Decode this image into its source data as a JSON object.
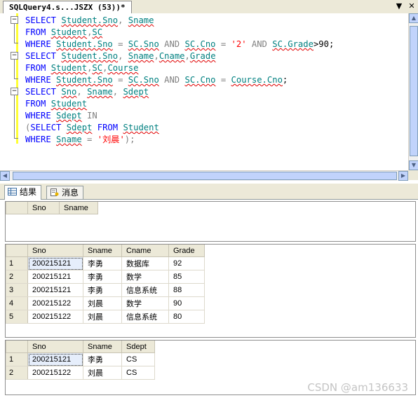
{
  "document_tab": {
    "title": "SQLQuery4.s...JSZX (53))*"
  },
  "editor": {
    "lines": [
      [
        {
          "t": "SELECT ",
          "c": "kw"
        },
        {
          "t": "Student.Sno",
          "c": "id"
        },
        {
          "t": ", ",
          "c": "op"
        },
        {
          "t": "Sname",
          "c": "id"
        }
      ],
      [
        {
          "t": "FROM ",
          "c": "kw"
        },
        {
          "t": "Student",
          "c": "id"
        },
        {
          "t": ",",
          "c": "op"
        },
        {
          "t": "SC",
          "c": "id"
        }
      ],
      [
        {
          "t": "WHERE ",
          "c": "kw"
        },
        {
          "t": "Student.Sno",
          "c": "id"
        },
        {
          "t": " = ",
          "c": "op"
        },
        {
          "t": "SC.Sno",
          "c": "id"
        },
        {
          "t": " AND ",
          "c": "op"
        },
        {
          "t": "SC.Cno",
          "c": "id"
        },
        {
          "t": " = ",
          "c": "op"
        },
        {
          "t": "'2'",
          "c": "str"
        },
        {
          "t": " AND ",
          "c": "op"
        },
        {
          "t": "SC.Grade",
          "c": "id"
        },
        {
          "t": ">90;",
          "c": "tx"
        }
      ],
      [
        {
          "t": "SELECT ",
          "c": "kw"
        },
        {
          "t": "Student.Sno",
          "c": "id"
        },
        {
          "t": ", ",
          "c": "op"
        },
        {
          "t": "Sname",
          "c": "id"
        },
        {
          "t": ",",
          "c": "op"
        },
        {
          "t": "Cname",
          "c": "id"
        },
        {
          "t": ",",
          "c": "op"
        },
        {
          "t": "Grade",
          "c": "id"
        }
      ],
      [
        {
          "t": "FROM ",
          "c": "kw"
        },
        {
          "t": "Student",
          "c": "id"
        },
        {
          "t": ",",
          "c": "op"
        },
        {
          "t": "SC",
          "c": "id"
        },
        {
          "t": ",",
          "c": "op"
        },
        {
          "t": "Course",
          "c": "id"
        }
      ],
      [
        {
          "t": "WHERE ",
          "c": "kw"
        },
        {
          "t": "Student.Sno",
          "c": "id"
        },
        {
          "t": " = ",
          "c": "op"
        },
        {
          "t": "SC.Sno",
          "c": "id"
        },
        {
          "t": " AND ",
          "c": "op"
        },
        {
          "t": "SC.Cno",
          "c": "id"
        },
        {
          "t": " = ",
          "c": "op"
        },
        {
          "t": "Course.Cno",
          "c": "id"
        },
        {
          "t": ";",
          "c": "tx"
        }
      ],
      [
        {
          "t": "SELECT ",
          "c": "kw"
        },
        {
          "t": "Sno",
          "c": "id"
        },
        {
          "t": ", ",
          "c": "op"
        },
        {
          "t": "Sname",
          "c": "id"
        },
        {
          "t": ", ",
          "c": "op"
        },
        {
          "t": "Sdept",
          "c": "id"
        }
      ],
      [
        {
          "t": "FROM ",
          "c": "kw"
        },
        {
          "t": "Student",
          "c": "id"
        }
      ],
      [
        {
          "t": "WHERE ",
          "c": "kw"
        },
        {
          "t": "Sdept",
          "c": "id"
        },
        {
          "t": " IN",
          "c": "op"
        }
      ],
      [
        {
          "t": "(",
          "c": "op"
        },
        {
          "t": "SELECT ",
          "c": "kw"
        },
        {
          "t": "Sdept",
          "c": "id"
        },
        {
          "t": " FROM ",
          "c": "kw"
        },
        {
          "t": "Student",
          "c": "id"
        }
      ],
      [
        {
          "t": "WHERE ",
          "c": "kw"
        },
        {
          "t": "Sname",
          "c": "id"
        },
        {
          "t": " = ",
          "c": "op"
        },
        {
          "t": "'刘晨'",
          "c": "str"
        },
        {
          "t": ");",
          "c": "op"
        }
      ]
    ]
  },
  "results_tabs": {
    "results": "结果",
    "messages": "消息"
  },
  "result_sets": [
    {
      "columns": [
        "Sno",
        "Sname"
      ],
      "rows": []
    },
    {
      "columns": [
        "Sno",
        "Sname",
        "Cname",
        "Grade"
      ],
      "rows": [
        [
          "1",
          "200215121",
          "李勇",
          "数据库",
          "92"
        ],
        [
          "2",
          "200215121",
          "李勇",
          "数学",
          "85"
        ],
        [
          "3",
          "200215121",
          "李勇",
          "信息系统",
          "88"
        ],
        [
          "4",
          "200215122",
          "刘晨",
          "数学",
          "90"
        ],
        [
          "5",
          "200215122",
          "刘晨",
          "信息系统",
          "80"
        ]
      ]
    },
    {
      "columns": [
        "Sno",
        "Sname",
        "Sdept"
      ],
      "rows": [
        [
          "1",
          "200215121",
          "李勇",
          "CS"
        ],
        [
          "2",
          "200215122",
          "刘晨",
          "CS"
        ]
      ]
    }
  ],
  "watermark": "CSDN @am136633",
  "colors": {
    "keyword": "#0000ff",
    "identifier": "#008080",
    "string": "#ff0000",
    "operator": "#808080",
    "change_bar": "#ffff33"
  },
  "icons": {
    "collapse": "minus-box-icon",
    "close": "close-icon",
    "dropdown": "chevron-down-icon"
  }
}
